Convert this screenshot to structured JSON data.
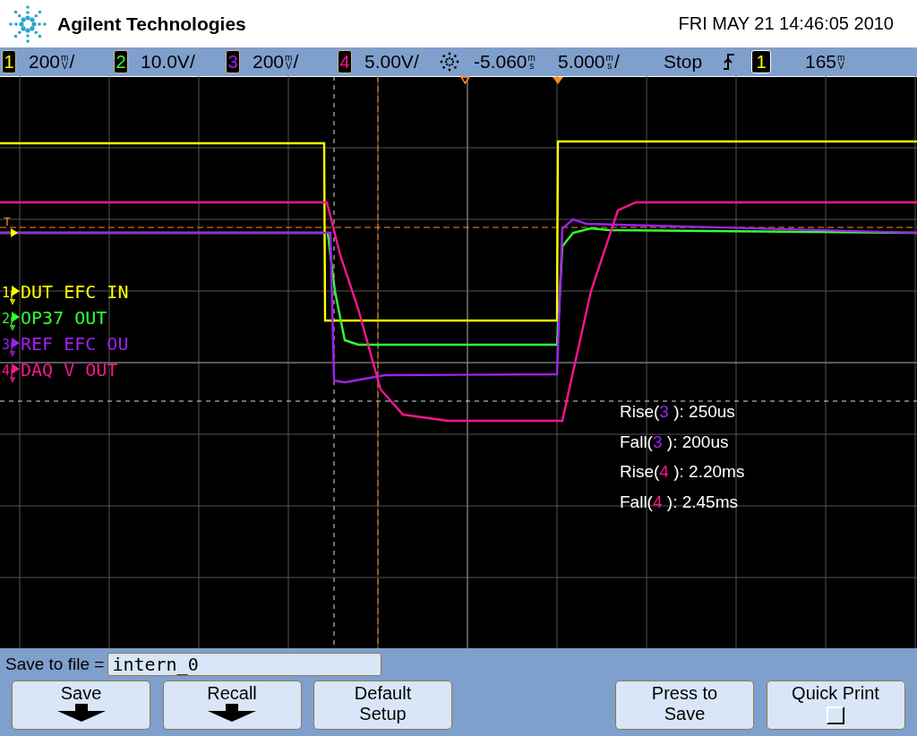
{
  "header": {
    "brand": "Agilent Technologies",
    "datetime": "FRI MAY 21 14:46:05 2010"
  },
  "channels": [
    {
      "number": "1",
      "marker": "1",
      "color": "#ffff00",
      "scale": {
        "text": "200",
        "unit": [
          "m",
          "V"
        ],
        "tail": "/"
      },
      "label": "DUT EFC IN"
    },
    {
      "number": "2",
      "marker": "2",
      "color": "#33ff33",
      "scale": {
        "text": "10.0V/"
      },
      "label": "OP37 OUT"
    },
    {
      "number": "3",
      "marker": "3",
      "color": "#a020f0",
      "scale": {
        "text": "200",
        "unit": [
          "m",
          "V"
        ],
        "tail": "/"
      },
      "label": "REF EFC OU"
    },
    {
      "number": "4",
      "marker": "4",
      "color": "#ff1493",
      "scale": {
        "text": "5.00V/"
      },
      "label": "DAQ V OUT"
    }
  ],
  "timebase": {
    "delay": {
      "text": "-5.060",
      "unit": [
        "m",
        "s"
      ]
    },
    "scale": {
      "text": "5.000",
      "unit": [
        "m",
        "s"
      ],
      "tail": "/"
    },
    "run_state": "Stop",
    "trigger_source": {
      "text": "1",
      "color": "#ffff00"
    },
    "trigger_level": {
      "text": "165",
      "unit": [
        "m",
        "V"
      ]
    }
  },
  "trigger_marker": "T",
  "measurements": [
    {
      "label": "Rise(",
      "channel": "3",
      "color": "#a020f0",
      "value": "): 250us"
    },
    {
      "label": "Fall(",
      "channel": "3",
      "color": "#a020f0",
      "value": "): 200us"
    },
    {
      "label": "Rise(",
      "channel": "4",
      "color": "#ff1493",
      "value": "): 2.20ms"
    },
    {
      "label": "Fall(",
      "channel": "4",
      "color": "#ff1493",
      "value": "): 2.45ms"
    }
  ],
  "save_to_file": {
    "label": "Save to file =",
    "value": "intern_0"
  },
  "softkeys": [
    {
      "kind": "menu",
      "lines": [
        "Save"
      ]
    },
    {
      "kind": "menu",
      "lines": [
        "Recall"
      ]
    },
    {
      "kind": "plain",
      "lines": [
        "Default",
        "Setup"
      ]
    },
    {
      "kind": "empty"
    },
    {
      "kind": "plain",
      "lines": [
        "Press to",
        "Save"
      ]
    },
    {
      "kind": "check",
      "lines": [
        "Quick Print"
      ],
      "checked": false
    }
  ]
}
